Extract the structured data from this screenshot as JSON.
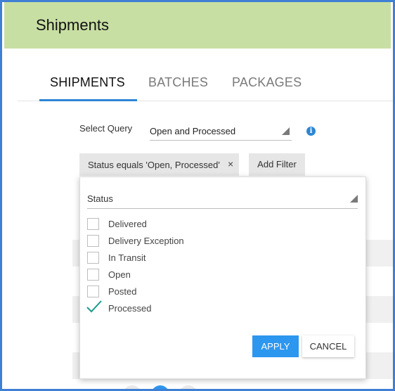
{
  "header": {
    "title": "Shipments"
  },
  "tabs": [
    {
      "label": "SHIPMENTS",
      "active": true
    },
    {
      "label": "BATCHES",
      "active": false
    },
    {
      "label": "PACKAGES",
      "active": false
    }
  ],
  "query": {
    "label": "Select Query",
    "value": "Open and Processed",
    "info_icon": "i"
  },
  "filter_chip": {
    "text": "Status equals 'Open, Processed'",
    "remove": "×"
  },
  "add_filter_label": "Add Filter",
  "status_popup": {
    "field_label": "Status",
    "options": [
      {
        "label": "Delivered",
        "checked": false
      },
      {
        "label": "Delivery Exception",
        "checked": false
      },
      {
        "label": "In Transit",
        "checked": false
      },
      {
        "label": "Open",
        "checked": false
      },
      {
        "label": "Posted",
        "checked": false
      },
      {
        "label": "Processed",
        "checked": true
      }
    ],
    "apply_label": "APPLY",
    "cancel_label": "CANCEL"
  },
  "colors": {
    "header_bg": "#c8dfa3",
    "accent": "#2d86d4",
    "apply_bg": "#2d96ef",
    "check": "#1a9a8a",
    "frame": "#3f7fd4"
  }
}
